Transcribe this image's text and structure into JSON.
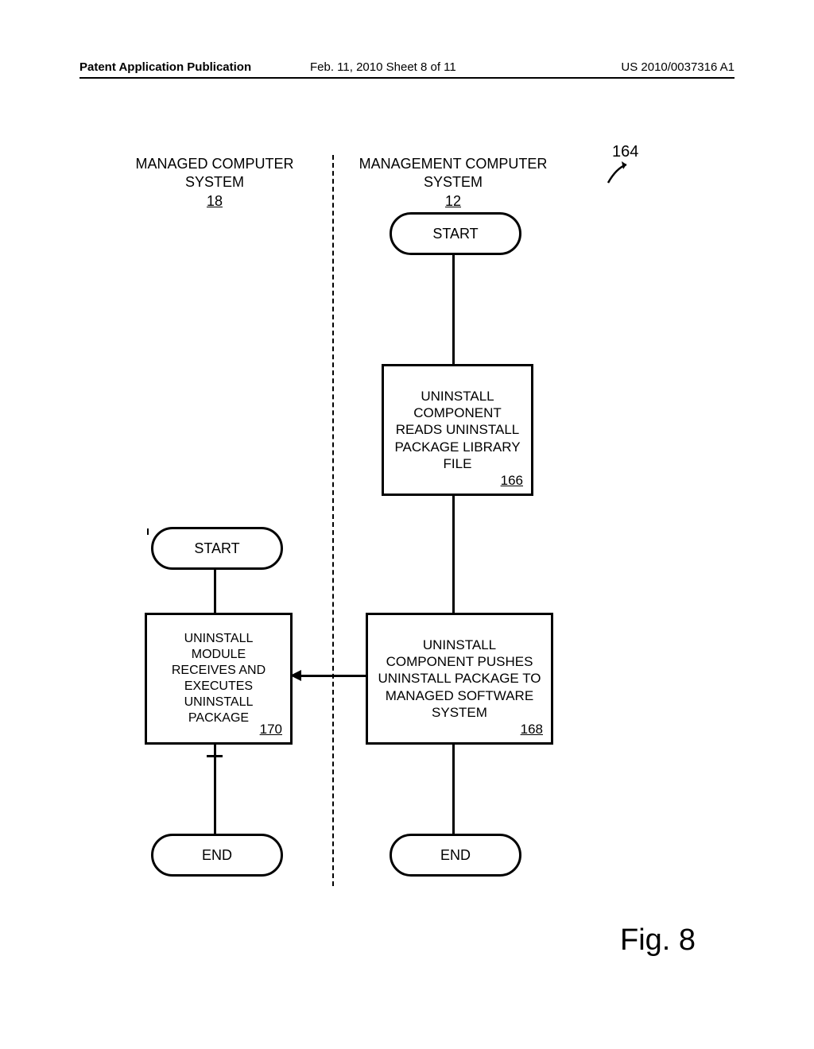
{
  "header": {
    "left": "Patent Application Publication",
    "mid": "Feb. 11, 2010   Sheet 8 of 11",
    "right": "US 2010/0037316 A1"
  },
  "columns": {
    "left_title_line1": "MANAGED COMPUTER",
    "left_title_line2": "SYSTEM",
    "left_ref": "18",
    "right_title_line1": "MANAGEMENT COMPUTER",
    "right_title_line2": "SYSTEM",
    "right_ref": "12"
  },
  "nodes": {
    "start_right": "START",
    "start_left": "START",
    "end_right": "END",
    "end_left": "END",
    "box166_l1": "UNINSTALL",
    "box166_l2": "COMPONENT",
    "box166_l3": "READS UNINSTALL",
    "box166_l4": "PACKAGE LIBRARY",
    "box166_l5": "FILE",
    "box166_ref": "166",
    "box168_l1": "UNINSTALL",
    "box168_l2": "COMPONENT PUSHES",
    "box168_l3": "UNINSTALL PACKAGE TO",
    "box168_l4": "MANAGED SOFTWARE",
    "box168_l5": "SYSTEM",
    "box168_ref": "168",
    "box170_l1": "UNINSTALL",
    "box170_l2": "MODULE",
    "box170_l3": "RECEIVES AND",
    "box170_l4": "EXECUTES",
    "box170_l5": "UNINSTALL",
    "box170_l6": "PACKAGE",
    "box170_ref": "170"
  },
  "figure_ref": "164",
  "figure_label": "Fig. 8"
}
